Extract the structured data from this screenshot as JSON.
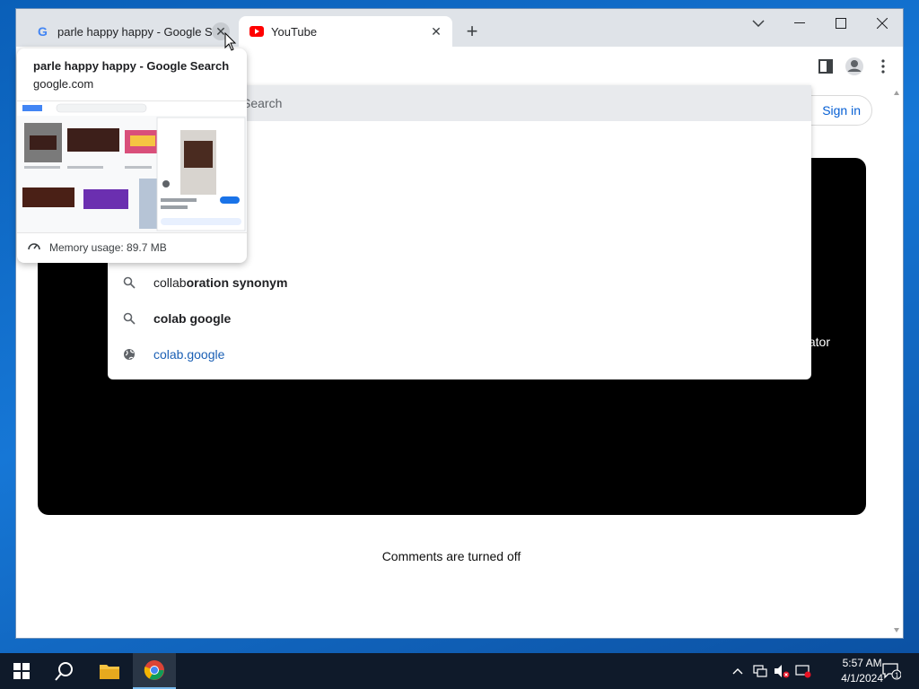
{
  "tabs": [
    {
      "title": "parle happy happy - Google Search",
      "favicon": "google-icon",
      "active": false
    },
    {
      "title": "YouTube",
      "favicon": "youtube-icon",
      "active": true
    }
  ],
  "hovercard": {
    "title": "parle happy happy - Google Search",
    "domain": "google.com",
    "memory": "Memory usage: 89.7 MB"
  },
  "omnibox": {
    "placeholder": "Search",
    "suggestions": [
      {
        "type": "search",
        "prefix": "collab",
        "rest": "oration synonym"
      },
      {
        "type": "search",
        "prefix": "",
        "rest": "colab google"
      },
      {
        "type": "url",
        "prefix": "colab.google",
        "rest": ""
      }
    ]
  },
  "page": {
    "signin": "Sign in",
    "video_overlay_fragment": "ator",
    "comments": "Comments are turned off"
  },
  "taskbar": {
    "time": "5:57 AM",
    "date": "4/1/2024",
    "notification_count": "1"
  },
  "colors": {
    "accent": "#065fd4",
    "youtube_red": "#ff0000"
  }
}
